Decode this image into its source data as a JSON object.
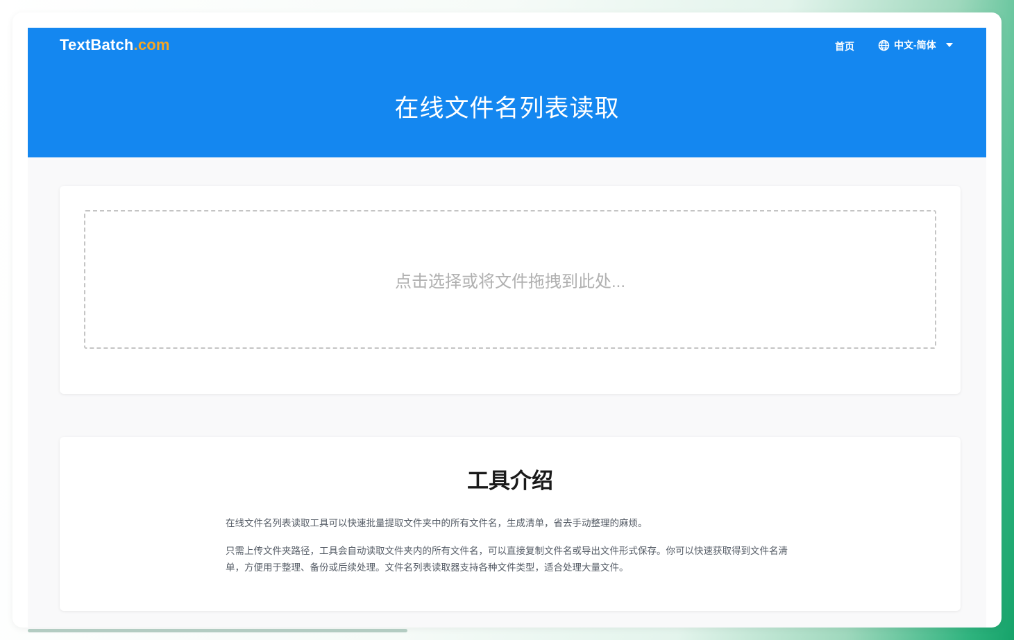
{
  "header": {
    "logo_main": "TextBatch",
    "logo_suffix": ".com",
    "nav_home": "首页",
    "language": "中文-简体",
    "language_icon": "globe-icon",
    "title": "在线文件名列表读取"
  },
  "upload": {
    "dropzone_text": "点击选择或将文件拖拽到此处..."
  },
  "intro": {
    "title": "工具介绍",
    "paragraph1": "在线文件名列表读取工具可以快速批量提取文件夹中的所有文件名，生成清单，省去手动整理的麻烦。",
    "paragraph2": "只需上传文件夹路径，工具会自动读取文件夹内的所有文件名，可以直接复制文件名或导出文件形式保存。你可以快速获取得到文件名清单，方便用于整理、备份或后续处理。文件名列表读取器支持各种文件类型，适合处理大量文件。"
  },
  "colors": {
    "header_bg": "#1487f0",
    "logo_accent": "#f5a623"
  }
}
